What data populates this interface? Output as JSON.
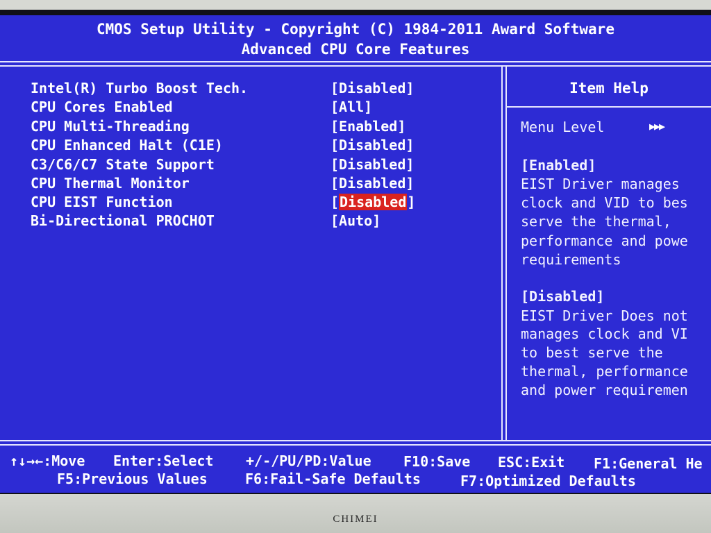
{
  "header": {
    "title": "CMOS Setup Utility - Copyright (C) 1984-2011 Award Software",
    "subtitle": "Advanced CPU Core Features"
  },
  "options": [
    {
      "label": "Intel(R) Turbo Boost Tech.",
      "value_open": "[",
      "value": "Disabled",
      "value_close": "]"
    },
    {
      "label": "CPU Cores Enabled",
      "value_open": "[",
      "value": "All",
      "value_close": "]"
    },
    {
      "label": "CPU Multi-Threading",
      "value_open": "[",
      "value": "Enabled",
      "value_close": "]"
    },
    {
      "label": "CPU Enhanced Halt (C1E)",
      "value_open": "[",
      "value": "Disabled",
      "value_close": "]"
    },
    {
      "label": "C3/C6/C7 State Support",
      "value_open": "[",
      "value": "Disabled",
      "value_close": "]"
    },
    {
      "label": "CPU Thermal Monitor",
      "value_open": "[",
      "value": "Disabled",
      "value_close": "]"
    },
    {
      "label": "CPU EIST Function",
      "value_open": "[",
      "value": "Disabled",
      "value_close": "]"
    },
    {
      "label": "Bi-Directional PROCHOT",
      "value_open": "[",
      "value": "Auto",
      "value_close": "]"
    }
  ],
  "selected_option": "CPU EIST Function",
  "help": {
    "title": "Item Help",
    "menu_level_label": "Menu Level",
    "menu_level_arrows": "▶▶▶",
    "enabled_heading": "[Enabled]",
    "enabled_lines": [
      "EIST Driver manages",
      "clock and VID to bes",
      "serve the thermal,",
      "performance and powe",
      "requirements"
    ],
    "disabled_heading": "[Disabled]",
    "disabled_lines": [
      "EIST Driver Does not",
      "manages clock and VI",
      "to best serve the",
      "thermal, performance",
      "and power requiremen"
    ]
  },
  "footer": {
    "line1": [
      "↑↓→←:Move",
      "Enter:Select",
      "+/-/PU/PD:Value",
      "F10:Save",
      "ESC:Exit",
      "F1:General He"
    ],
    "line2": [
      "F5:Previous Values",
      "F6:Fail-Safe Defaults",
      "F7:Optimized Defaults"
    ]
  },
  "monitor": {
    "brand": "CHIMEI"
  },
  "colors": {
    "background": "#2d2bd4",
    "text": "#ffffff",
    "highlight": "#d9231f"
  }
}
